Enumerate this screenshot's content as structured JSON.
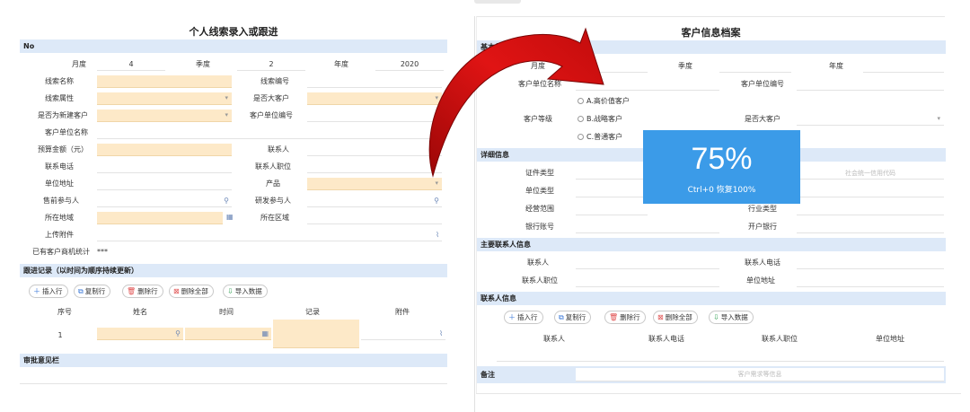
{
  "left_form": {
    "title": "个人线索录入或跟进",
    "section_no": "No",
    "fields": {
      "month_label": "月度",
      "month_value": "4",
      "quarter_label": "季度",
      "quarter_value": "2",
      "year_label": "年度",
      "year_value": "2020",
      "lead_name": "线索名称",
      "lead_code": "线索编号",
      "lead_attr": "线索属性",
      "is_major": "是否大客户",
      "is_new": "是否为新建客户",
      "customer_unit_code": "客户单位编号",
      "customer_unit_name": "客户单位名称",
      "budget": "预算金额（元）",
      "contact": "联系人",
      "phone": "联系电话",
      "contact_position": "联系人职位",
      "address": "单位地址",
      "product": "产品",
      "presale": "售前参与人",
      "rnd": "研发参与人",
      "region": "所在地域",
      "area": "所在区域",
      "attachment": "上传附件",
      "opportunity_stats": "已有客户商机统计",
      "opportunity_value": "***"
    },
    "followup_section": "跟进记录（以时间为顺序持续更新）",
    "toolbar": {
      "insert": "插入行",
      "copy": "复制行",
      "delete": "删除行",
      "delete_all": "删除全部",
      "import": "导入数据"
    },
    "table_headers": [
      "序号",
      "姓名",
      "时间",
      "记录",
      "附件"
    ],
    "row_index": "1",
    "approval_section": "审批意见栏"
  },
  "right_form": {
    "title": "客户信息档案",
    "basic_section": "基本信息",
    "fields": {
      "month": "月度",
      "quarter": "季度",
      "year": "年度",
      "unit_name": "客户单位名称",
      "unit_code": "客户单位编号",
      "level": "客户等级",
      "is_major": "是否大客户"
    },
    "level_options": [
      "A.高价值客户",
      "B.战略客户",
      "C.普通客户"
    ],
    "detail_section": "详细信息",
    "detail_fields": {
      "id_type": "证件类型",
      "credit_code_hint": "社会统一信用代码",
      "unit_type": "单位类型",
      "scope": "经营范围",
      "industry": "行业类型",
      "bank_account": "银行账号",
      "bank": "开户银行"
    },
    "main_contact_section": "主要联系人信息",
    "main_contact_fields": {
      "contact": "联系人",
      "contact_phone": "联系人电话",
      "contact_position": "联系人职位",
      "unit_address": "单位地址"
    },
    "contact_section": "联系人信息",
    "toolbar": {
      "insert": "插入行",
      "copy": "复制行",
      "delete": "删除行",
      "delete_all": "删除全部",
      "import": "导入数据"
    },
    "contact_table_headers": [
      "联系人",
      "联系人电话",
      "联系人职位",
      "单位地址"
    ],
    "remarks_label": "备注",
    "remarks_hint": "客户需求等信息"
  },
  "zoom_overlay": {
    "percent": "75%",
    "hint": "Ctrl+0 恢复100%"
  },
  "colors": {
    "section_bg": "#dde9f8",
    "required_field": "#fde9c8",
    "overlay_blue": "#3b9be8",
    "arrow_red": "#d40f0f"
  }
}
